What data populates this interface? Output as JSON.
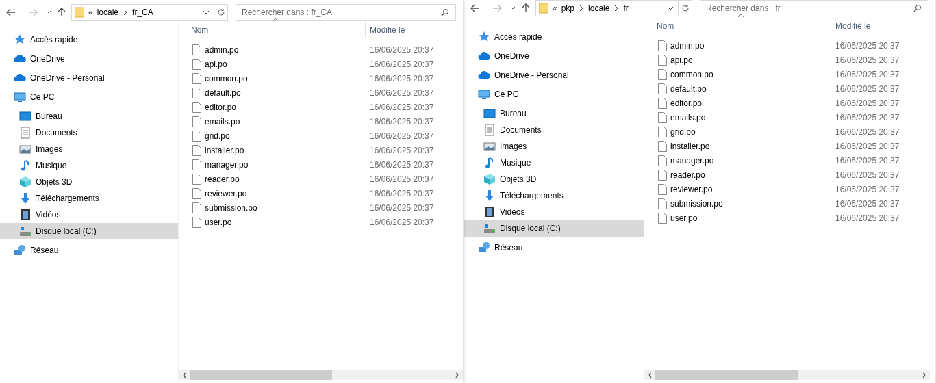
{
  "windows": [
    {
      "overflow_mark": "«",
      "path": [
        "locale",
        "fr_CA"
      ],
      "search": {
        "placeholder": "Rechercher dans : fr_CA"
      },
      "nav": [
        {
          "label": "Accès rapide",
          "kind": "quick",
          "selected": false
        },
        {
          "label": "OneDrive",
          "kind": "cloud",
          "selected": false
        },
        {
          "label": "OneDrive - Personal",
          "kind": "cloud",
          "selected": false
        },
        {
          "label": "Ce PC",
          "kind": "pc",
          "selected": false,
          "children": [
            {
              "label": "Bureau",
              "kind": "desktop",
              "selected": false
            },
            {
              "label": "Documents",
              "kind": "documents",
              "selected": false
            },
            {
              "label": "Images",
              "kind": "pictures",
              "selected": false
            },
            {
              "label": "Musique",
              "kind": "music",
              "selected": false
            },
            {
              "label": "Objets 3D",
              "kind": "cube",
              "selected": false
            },
            {
              "label": "Téléchargements",
              "kind": "download",
              "selected": false
            },
            {
              "label": "Vidéos",
              "kind": "video",
              "selected": false
            },
            {
              "label": "Disque local (C:)",
              "kind": "drive",
              "selected": true
            }
          ]
        },
        {
          "label": "Réseau",
          "kind": "network",
          "selected": false
        }
      ],
      "columns": [
        "Nom",
        "Modifié le"
      ],
      "files": [
        {
          "name": "admin.po",
          "modified": "16/06/2025 20:37"
        },
        {
          "name": "api.po",
          "modified": "16/06/2025 20:37"
        },
        {
          "name": "common.po",
          "modified": "16/06/2025 20:37"
        },
        {
          "name": "default.po",
          "modified": "16/06/2025 20:37"
        },
        {
          "name": "editor.po",
          "modified": "16/06/2025 20:37"
        },
        {
          "name": "emails.po",
          "modified": "16/06/2025 20:37"
        },
        {
          "name": "grid.po",
          "modified": "16/06/2025 20:37"
        },
        {
          "name": "installer.po",
          "modified": "16/06/2025 20:37"
        },
        {
          "name": "manager.po",
          "modified": "16/06/2025 20:37"
        },
        {
          "name": "reader.po",
          "modified": "16/06/2025 20:37"
        },
        {
          "name": "reviewer.po",
          "modified": "16/06/2025 20:37"
        },
        {
          "name": "submission.po",
          "modified": "16/06/2025 20:37"
        },
        {
          "name": "user.po",
          "modified": "16/06/2025 20:37"
        }
      ]
    },
    {
      "overflow_mark": "«",
      "path": [
        "pkp",
        "locale",
        "fr"
      ],
      "search": {
        "placeholder": "Rechercher dans : fr"
      },
      "nav": [
        {
          "label": "Accès rapide",
          "kind": "quick",
          "selected": false
        },
        {
          "label": "OneDrive",
          "kind": "cloud",
          "selected": false
        },
        {
          "label": "OneDrive - Personal",
          "kind": "cloud",
          "selected": false
        },
        {
          "label": "Ce PC",
          "kind": "pc",
          "selected": false,
          "children": [
            {
              "label": "Bureau",
              "kind": "desktop",
              "selected": false
            },
            {
              "label": "Documents",
              "kind": "documents",
              "selected": false
            },
            {
              "label": "Images",
              "kind": "pictures",
              "selected": false
            },
            {
              "label": "Musique",
              "kind": "music",
              "selected": false
            },
            {
              "label": "Objets 3D",
              "kind": "cube",
              "selected": false
            },
            {
              "label": "Téléchargements",
              "kind": "download",
              "selected": false
            },
            {
              "label": "Vidéos",
              "kind": "video",
              "selected": false
            },
            {
              "label": "Disque local (C:)",
              "kind": "drive",
              "selected": true
            }
          ]
        },
        {
          "label": "Réseau",
          "kind": "network",
          "selected": false
        }
      ],
      "columns": [
        "Nom",
        "Modifié le"
      ],
      "files": [
        {
          "name": "admin.po",
          "modified": "16/06/2025 20:37"
        },
        {
          "name": "api.po",
          "modified": "16/06/2025 20:37"
        },
        {
          "name": "common.po",
          "modified": "16/06/2025 20:37"
        },
        {
          "name": "default.po",
          "modified": "16/06/2025 20:37"
        },
        {
          "name": "editor.po",
          "modified": "16/06/2025 20:37"
        },
        {
          "name": "emails.po",
          "modified": "16/06/2025 20:37"
        },
        {
          "name": "grid.po",
          "modified": "16/06/2025 20:37"
        },
        {
          "name": "installer.po",
          "modified": "16/06/2025 20:37"
        },
        {
          "name": "manager.po",
          "modified": "16/06/2025 20:37"
        },
        {
          "name": "reader.po",
          "modified": "16/06/2025 20:37"
        },
        {
          "name": "reviewer.po",
          "modified": "16/06/2025 20:37"
        },
        {
          "name": "submission.po",
          "modified": "16/06/2025 20:37"
        },
        {
          "name": "user.po",
          "modified": "16/06/2025 20:37"
        }
      ]
    }
  ]
}
